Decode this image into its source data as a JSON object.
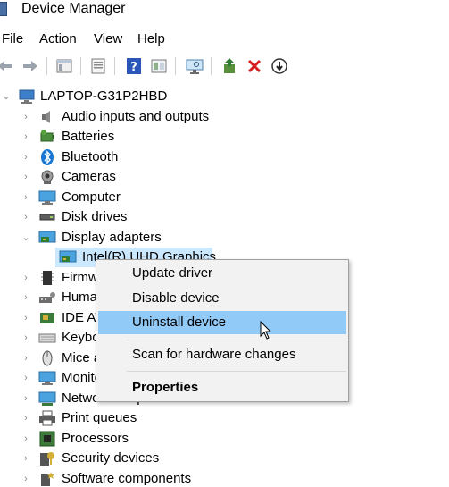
{
  "window": {
    "title": "Device Manager"
  },
  "menubar": {
    "items": [
      "File",
      "Action",
      "View",
      "Help"
    ]
  },
  "toolbar": {
    "buttons": [
      "back-icon",
      "forward-icon",
      "show-hide-tree-icon",
      "properties-icon",
      "help-icon",
      "update-driver-view-icon",
      "scan-hardware-icon",
      "add-driver-icon",
      "uninstall-x-icon",
      "disable-device-icon"
    ]
  },
  "tree": {
    "root": "LAPTOP-G31P2HBD",
    "items": [
      {
        "label": "Audio inputs and outputs",
        "icon": "speaker-icon"
      },
      {
        "label": "Batteries",
        "icon": "battery-icon"
      },
      {
        "label": "Bluetooth",
        "icon": "bluetooth-icon"
      },
      {
        "label": "Cameras",
        "icon": "camera-icon"
      },
      {
        "label": "Computer",
        "icon": "computer-icon"
      },
      {
        "label": "Disk drives",
        "icon": "disk-drive-icon"
      },
      {
        "label": "Display adapters",
        "icon": "display-adapter-icon"
      },
      {
        "label": "Intel(R) UHD Graphics",
        "icon": "display-adapter-icon"
      },
      {
        "label": "Firmware",
        "icon": "firmware-icon"
      },
      {
        "label": "Human Interface Devices",
        "icon": "hid-icon"
      },
      {
        "label": "IDE ATA/ATAPI controllers",
        "icon": "ide-icon"
      },
      {
        "label": "Keyboards",
        "icon": "keyboard-icon"
      },
      {
        "label": "Mice and other pointing devices",
        "icon": "mouse-icon"
      },
      {
        "label": "Monitors",
        "icon": "monitor-icon"
      },
      {
        "label": "Network adapters",
        "icon": "network-icon"
      },
      {
        "label": "Print queues",
        "icon": "printer-icon"
      },
      {
        "label": "Processors",
        "icon": "processor-icon"
      },
      {
        "label": "Security devices",
        "icon": "security-icon"
      },
      {
        "label": "Software components",
        "icon": "software-components-icon"
      }
    ]
  },
  "context_menu": {
    "update_driver": "Update driver",
    "disable_device": "Disable device",
    "uninstall_device": "Uninstall device",
    "scan_hardware": "Scan for hardware changes",
    "properties": "Properties"
  }
}
